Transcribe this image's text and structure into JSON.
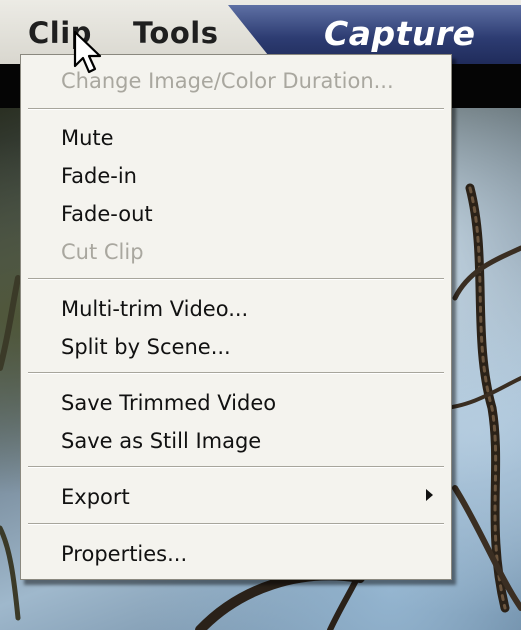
{
  "menubar": {
    "clip": "Clip",
    "tools": "Tools",
    "capture_tab": "Capture"
  },
  "clip_menu": {
    "items": [
      {
        "label": "Change Image/Color Duration...",
        "enabled": false
      },
      {
        "label": "Mute",
        "enabled": true
      },
      {
        "label": "Fade-in",
        "enabled": true
      },
      {
        "label": "Fade-out",
        "enabled": true
      },
      {
        "label": "Cut Clip",
        "enabled": false
      },
      {
        "label": "Multi-trim Video...",
        "enabled": true
      },
      {
        "label": "Split by Scene...",
        "enabled": true
      },
      {
        "label": "Save Trimmed Video",
        "enabled": true
      },
      {
        "label": "Save as Still Image",
        "enabled": true
      },
      {
        "label": "Export",
        "enabled": true,
        "has_submenu": true
      },
      {
        "label": "Properties...",
        "enabled": true
      }
    ]
  },
  "icons": {
    "cursor": "arrow-cursor-icon",
    "submenu": "submenu-arrow-icon"
  },
  "colors": {
    "capture_tab": "#2d3c72",
    "menu_background": "#f4f3ee",
    "disabled_text": "#a9a79f"
  }
}
